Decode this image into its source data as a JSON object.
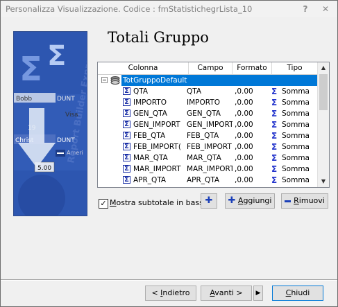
{
  "window": {
    "title": "Personalizza Visualizzazione. Codice : fmStatistichegrLista_10",
    "help": "?",
    "close": "✕"
  },
  "heading": "Totali Gruppo",
  "grid": {
    "columns": [
      "Colonna",
      "Campo",
      "Formato",
      "Tipo"
    ],
    "group": "TotGruppoDefault",
    "rows": [
      {
        "colonna": "QTA",
        "campo": "QTA",
        "formato": ",0.00",
        "tipo": "Somma"
      },
      {
        "colonna": "IMPORTO",
        "campo": "IMPORTO",
        "formato": ",0.00",
        "tipo": "Somma"
      },
      {
        "colonna": "GEN_QTA",
        "campo": "GEN_QTA",
        "formato": ",0.00",
        "tipo": "Somma"
      },
      {
        "colonna": "GEN_IMPORT",
        "campo": "GEN_IMPORT",
        "formato": ",0.00",
        "tipo": "Somma"
      },
      {
        "colonna": "FEB_QTA",
        "campo": "FEB_QTA",
        "formato": ",0.00",
        "tipo": "Somma"
      },
      {
        "colonna": "FEB_IMPORT(",
        "campo": "FEB_IMPORT",
        "formato": ",0.00",
        "tipo": "Somma"
      },
      {
        "colonna": "MAR_QTA",
        "campo": "MAR_QTA",
        "formato": ",0.00",
        "tipo": "Somma"
      },
      {
        "colonna": "MAR_IMPORT",
        "campo": "MAR_IMPORT",
        "formato": ",0.00",
        "tipo": "Somma"
      },
      {
        "colonna": "APR_QTA",
        "campo": "APR_QTA",
        "formato": ",0.00",
        "tipo": "Somma"
      }
    ]
  },
  "options": {
    "mostra_subtotale_label": "Mostra subtotale in basso",
    "mostra_subtotale_checked": true
  },
  "buttons": {
    "add_icon": "✚",
    "aggiungi": "Aggiungi",
    "rimuovi": "Rimuovi",
    "indietro": "< Indietro",
    "avanti": "Avanti >",
    "chiudi": "Chiudi"
  },
  "wizard_image": {
    "texts": [
      "Bobb",
      "DUNT",
      "Visa",
      "19",
      "Christ",
      "DUNT",
      "Ameri",
      "5.00",
      "Report Builder Express"
    ]
  }
}
